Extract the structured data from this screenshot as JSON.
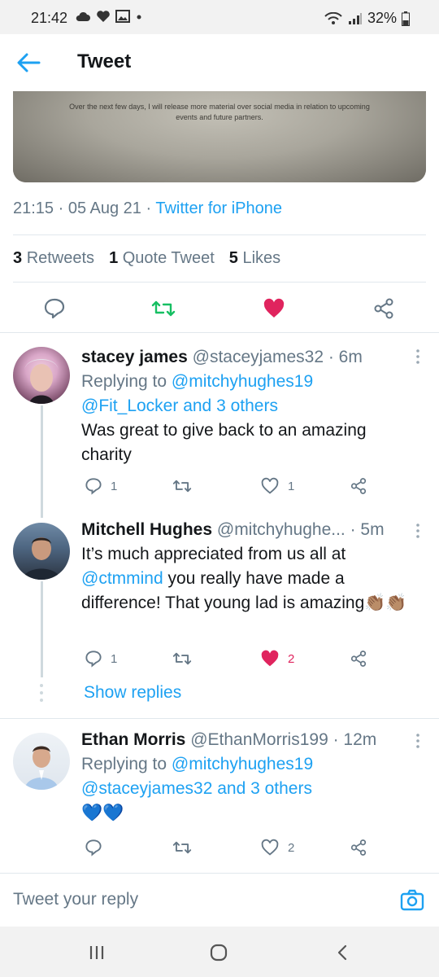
{
  "status_bar": {
    "time": "21:42",
    "battery": "32%"
  },
  "header": {
    "title": "Tweet"
  },
  "media": {
    "caption": "Over the next few days, I will release more material over social media in relation to upcoming events and future partners."
  },
  "tweet_meta": {
    "time": "21:15",
    "separator": " · ",
    "date": "05 Aug 21",
    "source": "Twitter for iPhone"
  },
  "stats": {
    "retweets_count": "3",
    "retweets_label": "Retweets",
    "quotes_count": "1",
    "quotes_label": "Quote Tweet",
    "likes_count": "5",
    "likes_label": "Likes"
  },
  "replies": [
    {
      "name": "stacey james",
      "handle": "@staceyjames32",
      "time": "· 6m",
      "replying_prefix": "Replying to ",
      "replying_to": "@mitchyhughes19",
      "replying_others_handle": "@Fit_Locker",
      "replying_others_suffix": " and 3 others",
      "text": "Was great to give back to an amazing charity",
      "reply_count": "1",
      "retweet_count": "",
      "like_count": "1",
      "liked": false
    },
    {
      "name": "Mitchell Hughes",
      "handle": "@mitchyhughe...",
      "time": "· 5m",
      "text_before": "It’s much appreciated from us all at ",
      "mention": "@ctmmind",
      "text_after": " you really have made a difference! That young lad is amazing",
      "emoji": "👏🏽👏🏽",
      "reply_count": "1",
      "retweet_count": "",
      "like_count": "2",
      "liked": true
    },
    {
      "name": "Ethan Morris",
      "handle": "@EthanMorris199",
      "time": "· 12m",
      "replying_prefix": "Replying to ",
      "replying_to": "@mitchyhughes19",
      "replying_others_handle": "@staceyjames32",
      "replying_others_suffix": " and 3 others",
      "emoji": "💙💙",
      "reply_count": "",
      "retweet_count": "",
      "like_count": "2",
      "liked": false
    }
  ],
  "show_replies": "Show replies",
  "reply_bar": {
    "placeholder": "Tweet your reply"
  },
  "colors": {
    "accent": "#1da1f2",
    "like": "#e0245e",
    "retweet": "#17bf63",
    "muted": "#657786"
  },
  "icons": [
    "back-arrow-icon",
    "comment-icon",
    "retweet-icon",
    "heart-icon",
    "share-icon",
    "kebab-icon",
    "camera-icon",
    "recents-icon",
    "home-icon",
    "back-icon"
  ]
}
